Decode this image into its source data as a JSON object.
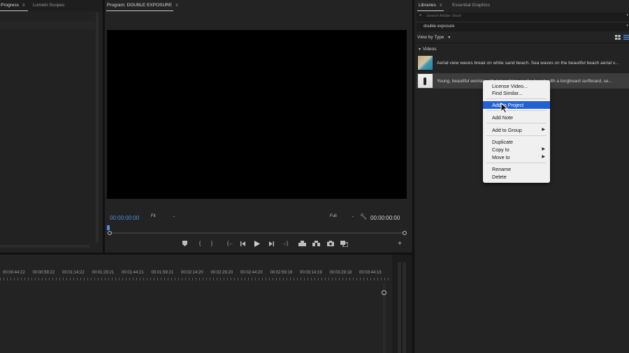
{
  "left_panel": {
    "tabs": [
      {
        "label": "Progress",
        "active": true
      },
      {
        "label": "Lumetri Scopes",
        "active": false
      }
    ]
  },
  "program_monitor": {
    "title": "Program: DOUBLE EXPOSURE",
    "current_timecode": "00:00:00:00",
    "zoom": "Fit",
    "resolution": "Full",
    "duration_timecode": "00:00:00:00",
    "controls": {
      "marker": "⬟",
      "mark_in": "{",
      "mark_out": "}",
      "go_in": "{←",
      "step_back": "◀|",
      "play": "▶",
      "step_forward": "|▶",
      "go_out": "→}",
      "lift": "⏏",
      "extract": "⎘",
      "export_frame": "📷",
      "comparison": "⧉",
      "add": "+"
    }
  },
  "timeline": {
    "ruler": [
      "00:00:44:22",
      "00:00:59:22",
      "00:01:14:22",
      "00:01:29:21",
      "00:01:44:21",
      "00:01:59:21",
      "00:02:14:20",
      "00:02:29:20",
      "00:02:44:20",
      "00:02:59:19",
      "00:03:14:19",
      "00:03:29:18",
      "00:03:44:18"
    ]
  },
  "libraries": {
    "tabs": [
      {
        "label": "Libraries",
        "active": true
      },
      {
        "label": "Essential Graphics",
        "active": false
      }
    ],
    "search_placeholder": "Search Adobe Stock",
    "library_name": "double exposure",
    "view_by": "View by Type",
    "section": "Videos",
    "items": [
      {
        "text": "Aerial view waves break on white sand beach. Sea waves on the beautiful beach aerial v...",
        "thumb_color": "#b9a884"
      },
      {
        "text": "Young, beautiful woman with hat walking on the beach with a longboard surfboard, se...",
        "thumb_color": "#e8e8e8"
      }
    ]
  },
  "context_menu": {
    "items": [
      {
        "label": "License Video..."
      },
      {
        "label": "Find Similar..."
      },
      {
        "label": "Add to Project",
        "highlighted": true
      },
      {
        "label": "Add Note"
      },
      {
        "label": "Add to Group",
        "submenu": true
      },
      {
        "label": "Duplicate"
      },
      {
        "label": "Copy to",
        "submenu": true
      },
      {
        "label": "Move to",
        "submenu": true
      },
      {
        "label": "Rename"
      },
      {
        "label": "Delete"
      }
    ]
  },
  "colors": {
    "accent_blue": "#2261d4",
    "timecode_blue": "#4f8fe0",
    "panel_bg": "#232323",
    "menu_bg": "#f0f0f0"
  }
}
